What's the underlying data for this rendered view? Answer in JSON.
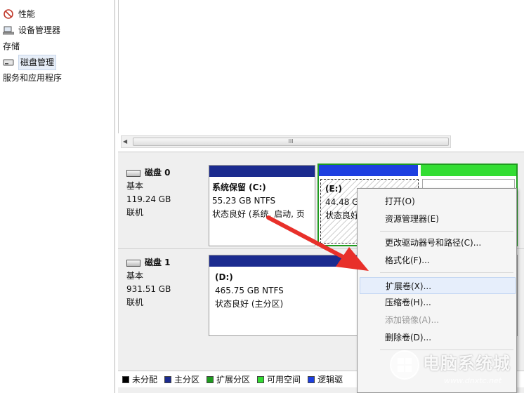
{
  "tree": {
    "items": [
      {
        "label": "性能",
        "icon": "performance-icon"
      },
      {
        "label": "设备管理器",
        "icon": "device-manager-icon"
      },
      {
        "label": "存储",
        "icon": ""
      },
      {
        "label": "磁盘管理",
        "icon": "disk-management-icon"
      },
      {
        "label": "服务和应用程序",
        "icon": ""
      }
    ]
  },
  "scrollbar": {
    "grip": "III"
  },
  "disks": [
    {
      "name": "磁盘 0",
      "type": "基本",
      "size": "119.24 GB",
      "status": "联机"
    },
    {
      "name": "磁盘 1",
      "type": "基本",
      "size": "931.51 GB",
      "status": "联机"
    }
  ],
  "partitions": {
    "c": {
      "name": "系统保留 (C:)",
      "size": "55.23 GB NTFS",
      "status": "状态良好 (系统, 启动, 页"
    },
    "e": {
      "name": "(E:)",
      "size": "44.48 G",
      "status": "状态良好"
    },
    "d": {
      "name": "(D:)",
      "size": "465.75 GB NTFS",
      "status": "状态良好 (主分区)"
    }
  },
  "legend": [
    {
      "label": "未分配",
      "color": "#000000"
    },
    {
      "label": "主分区",
      "color": "#1b2b8f"
    },
    {
      "label": "扩展分区",
      "color": "#1f9b1f"
    },
    {
      "label": "可用空间",
      "color": "#33dd33"
    },
    {
      "label": "逻辑驱",
      "color": "#1d3fe0"
    }
  ],
  "context_menu": {
    "items": [
      {
        "label": "打开(O)",
        "enabled": true
      },
      {
        "label": "资源管理器(E)",
        "enabled": true
      },
      {
        "label": "更改驱动器号和路径(C)...",
        "enabled": true
      },
      {
        "label": "格式化(F)...",
        "enabled": true
      },
      {
        "label": "扩展卷(X)...",
        "enabled": true,
        "highlighted": true
      },
      {
        "label": "压缩卷(H)...",
        "enabled": true
      },
      {
        "label": "添加镜像(A)...",
        "enabled": false
      },
      {
        "label": "删除卷(D)...",
        "enabled": true
      }
    ]
  },
  "watermark": {
    "title": "电脑系统城",
    "url": "www.dnxtc.net"
  },
  "colors": {
    "primary": "#1b2b8f",
    "logical": "#1d3fe0",
    "free": "#33dd33",
    "extended": "#1f9b1f",
    "arrow": "#e8302a"
  }
}
